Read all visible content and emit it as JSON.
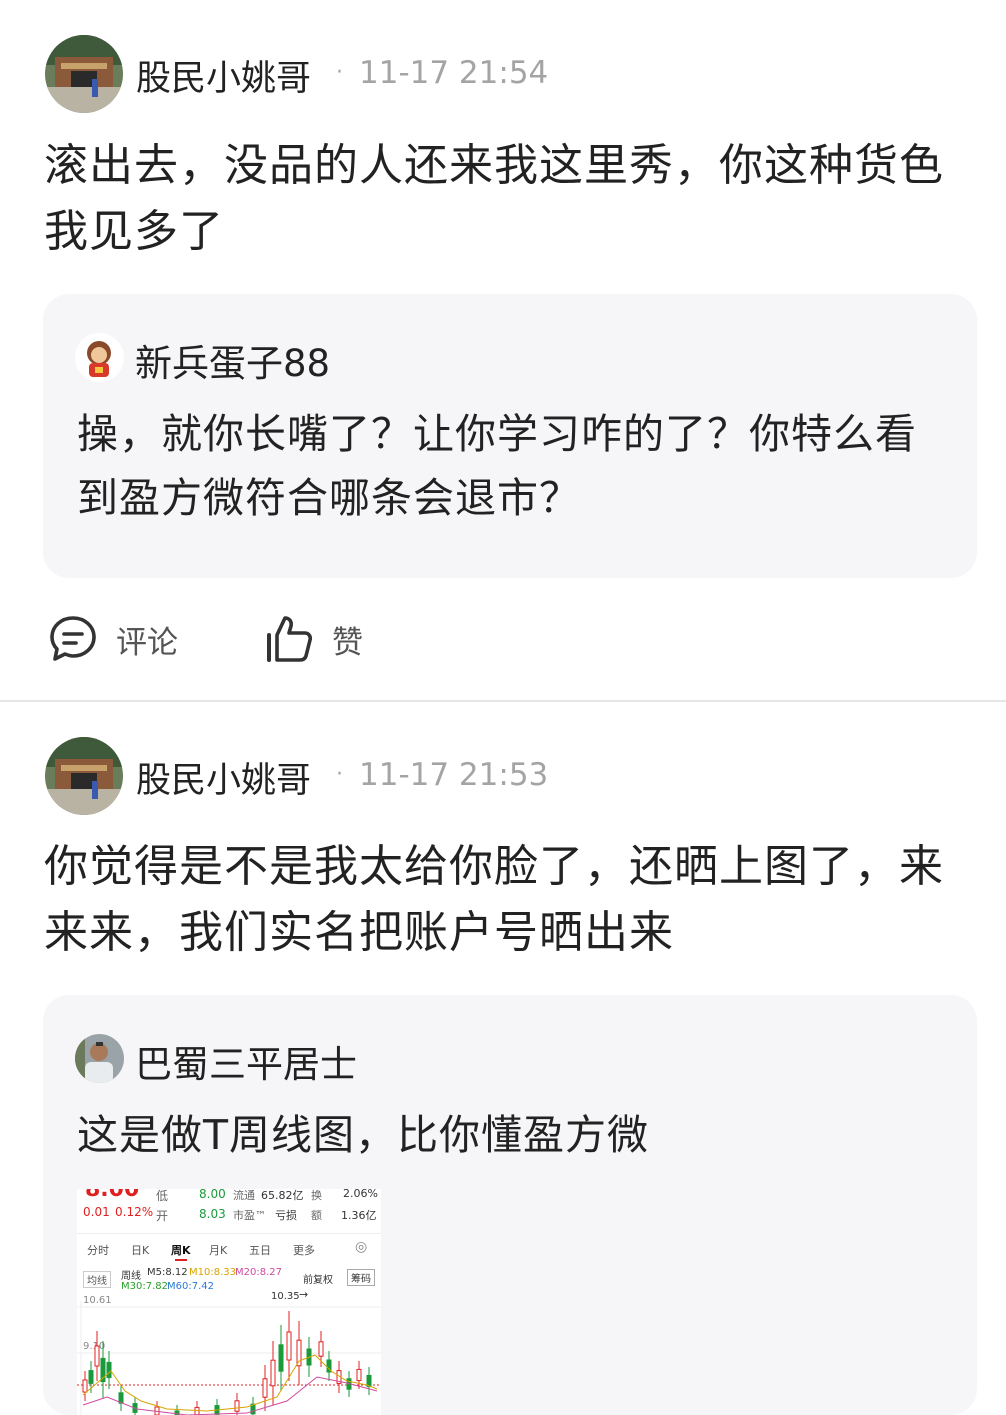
{
  "colors": {
    "text": "#222222",
    "muted": "#a4a4a4",
    "quote_bg": "#f6f6f8",
    "up": "#e02020",
    "down": "#1a9a3a"
  },
  "posts": [
    {
      "author": "股民小姚哥",
      "dot": "·",
      "time": "11-17 21:54",
      "text_lines": [
        "滚出去，没品的人还来我这里秀，你这种货色",
        "我见多了"
      ],
      "quote": {
        "author": "新兵蛋子88",
        "text_lines": [
          "操，就你长嘴了？让你学习咋的了？你特么看",
          "到盈方微符合哪条会退市？"
        ]
      },
      "actions": {
        "comment_label": "评论",
        "like_label": "赞"
      }
    },
    {
      "author": "股民小姚哥",
      "dot": "·",
      "time": "11-17 21:53",
      "text_lines": [
        "你觉得是不是我太给你脸了，还晒上图了，来",
        "来来，我们实名把账户号晒出来"
      ],
      "quote": {
        "author": "巴蜀三平居士",
        "text_lines": [
          "这是做T周线图，比你懂盈方微"
        ],
        "image": {
          "change": "0.01",
          "change_pct": "0.12%",
          "low_label": "低",
          "low_value": "8.00",
          "open_label": "开",
          "open_value": "8.03",
          "float_label": "流通",
          "float_value": "65.82亿",
          "turnover_label": "换",
          "turnover_value": "2.06%",
          "pe_label": "市盈™",
          "pe_value": "亏损",
          "amount_label": "额",
          "amount_value": "1.36亿",
          "tabs": [
            "分时",
            "日K",
            "周K",
            "月K",
            "五日",
            "更多"
          ],
          "active_tab": "周K",
          "ma_button": "均线",
          "ma_label": "周线",
          "m5": "M5:8.12",
          "m10": "M10:8.33",
          "m20": "M20:8.27",
          "m30": "M30:7.82",
          "m60": "M60:7.42",
          "adjust": "前复权",
          "chips": "筹码",
          "high_price": "10.61",
          "mid_price": "9.10",
          "peak_label": "10.35"
        }
      }
    }
  ]
}
